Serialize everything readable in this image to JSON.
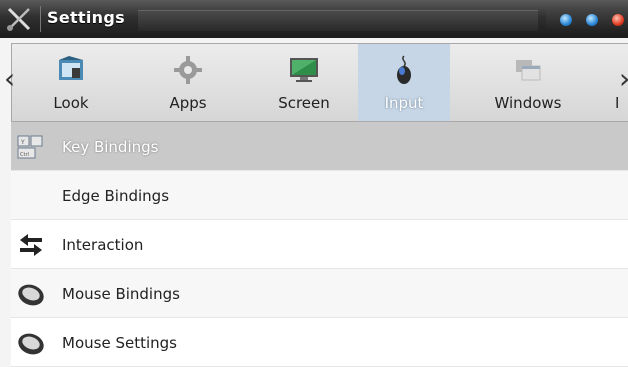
{
  "window": {
    "title": "Settings",
    "app_icon": "settings-tools-icon",
    "buttons": [
      "minimize-icon",
      "maximize-icon",
      "close-icon"
    ]
  },
  "categories": {
    "left_arrow": "‹",
    "right_arrow": "›",
    "items": [
      {
        "label": "Look",
        "icon": "look-icon",
        "active": false
      },
      {
        "label": "Apps",
        "icon": "apps-gear-icon",
        "active": false
      },
      {
        "label": "Screen",
        "icon": "screen-monitor-icon",
        "active": false
      },
      {
        "label": "Input",
        "icon": "input-icon",
        "active": true
      },
      {
        "label": "Windows",
        "icon": "windows-icon",
        "active": false
      },
      {
        "label": "M",
        "icon": "more-icon",
        "active": false
      }
    ]
  },
  "list": {
    "items": [
      {
        "label": "Key Bindings",
        "icon": "keyboard-icon",
        "selected": true
      },
      {
        "label": "Edge Bindings",
        "icon": "",
        "selected": false
      },
      {
        "label": "Interaction",
        "icon": "interaction-arrows-icon",
        "selected": false
      },
      {
        "label": "Mouse Bindings",
        "icon": "mouse-icon",
        "selected": false
      },
      {
        "label": "Mouse Settings",
        "icon": "mouse-icon",
        "selected": false
      }
    ]
  }
}
